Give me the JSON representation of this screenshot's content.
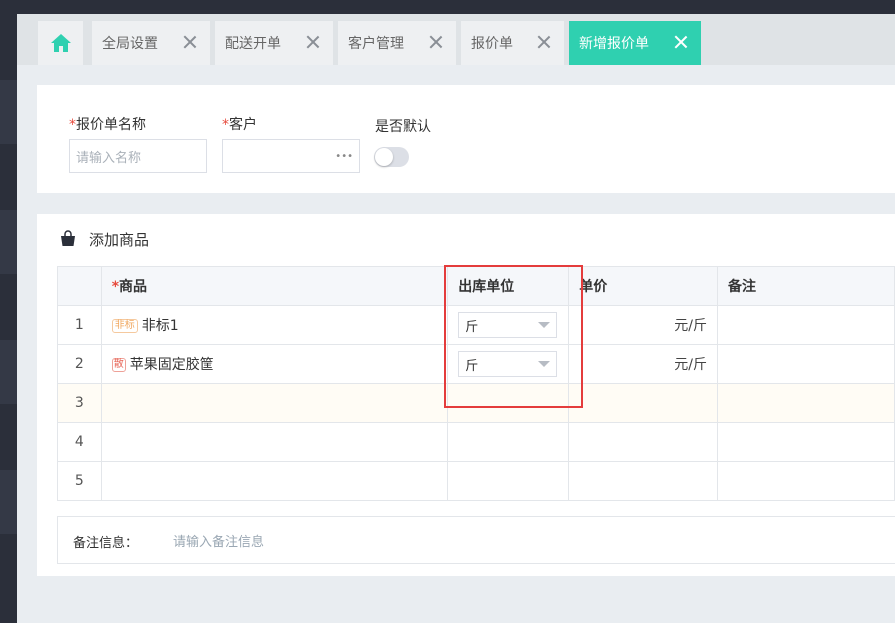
{
  "tabs": [
    {
      "icon": "home-icon",
      "label": ""
    },
    {
      "label": "全局设置"
    },
    {
      "label": "配送开单"
    },
    {
      "label": "客户管理"
    },
    {
      "label": "报价单"
    },
    {
      "label": "新增报价单",
      "active": true
    }
  ],
  "form": {
    "name_label": "报价单名称",
    "name_placeholder": "请输入名称",
    "customer_label": "客户",
    "customer_dots": "•••",
    "default_label": "是否默认",
    "required_mark": "*"
  },
  "goods": {
    "section_title": "添加商品",
    "columns": [
      "商品",
      "出库单位",
      "单价",
      "备注"
    ],
    "rows": [
      {
        "index": "1",
        "tag": "非标",
        "name": "非标1",
        "unit": "斤",
        "price": "元/斤"
      },
      {
        "index": "2",
        "tag": "散",
        "name": "苹果固定胶筐",
        "unit": "斤",
        "price": "元/斤"
      },
      {
        "index": "3",
        "tag": "",
        "name": "",
        "unit": "",
        "price": ""
      },
      {
        "index": "4",
        "tag": "",
        "name": "",
        "unit": "",
        "price": ""
      },
      {
        "index": "5",
        "tag": "",
        "name": "",
        "unit": "",
        "price": ""
      }
    ]
  },
  "remark": {
    "label": "备注信息：",
    "placeholder": "请输入备注信息"
  },
  "colors": {
    "accent": "#2fd0b0",
    "required": "#e64a3c",
    "highlight_box": "#e43c3c"
  }
}
